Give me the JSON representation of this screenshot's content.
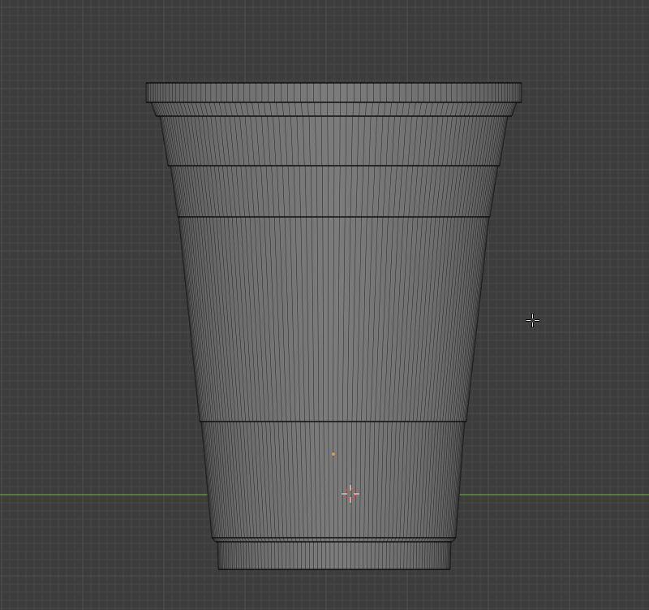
{
  "viewport": {
    "view": "front-orthographic",
    "background_color": "#3d3d3d",
    "grid_minor_color": "#474747",
    "grid_major_color": "#505050",
    "x_axis_color": "#6f9a3a",
    "mesh_face_color": "#7a7a7a",
    "mesh_edge_color": "#222222",
    "edge_loop_color": "#0f0f0f",
    "origin_point_color": "#e8a04a",
    "cursor_3d_color": "#e04a4a"
  },
  "model": {
    "object_type": "mesh",
    "description_shape": "cup",
    "vertical_edge_count": 88
  },
  "icons": {
    "cursor_3d": "3d-cursor-icon",
    "origin": "object-origin-icon",
    "mouse_cursor": "crosshair-cursor-icon"
  }
}
